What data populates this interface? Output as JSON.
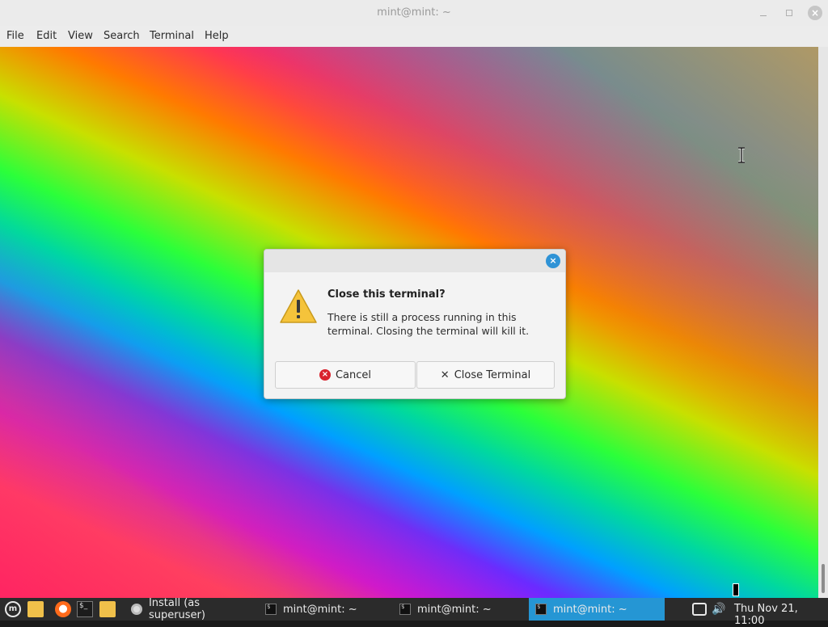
{
  "window": {
    "title": "mint@mint: ~",
    "controls": {
      "minimize": "minimize-icon",
      "maximize": "maximize-icon",
      "close": "close-icon"
    }
  },
  "menubar": {
    "items": [
      "File",
      "Edit",
      "View",
      "Search",
      "Terminal",
      "Help"
    ]
  },
  "dialog": {
    "heading": "Close this terminal?",
    "body": "There is still a process running in this terminal. Closing the terminal will kill it.",
    "cancel_label": "Cancel",
    "close_label": "Close Terminal",
    "icons": {
      "warning": "warning-icon",
      "cancel": "cancel-icon",
      "close": "x-icon"
    }
  },
  "taskbar": {
    "launchers": [
      "mint-menu-icon",
      "folder-icon",
      "firefox-icon",
      "terminal-icon",
      "files-icon"
    ],
    "tasks": [
      {
        "label": "Install (as superuser)",
        "icon": "cd-icon",
        "active": false
      },
      {
        "label": "mint@mint: ~",
        "icon": "terminal-icon",
        "active": false
      },
      {
        "label": "mint@mint: ~",
        "icon": "terminal-icon",
        "active": false
      },
      {
        "label": "mint@mint: ~",
        "icon": "terminal-icon",
        "active": true
      }
    ],
    "tray": [
      "network-icon",
      "volume-icon"
    ],
    "clock": "Thu Nov 21, 11:00"
  },
  "colors": {
    "taskbar_bg": "#2b2b2b",
    "active_task": "#2596d4",
    "dialog_close": "#2f93d6",
    "cancel_red": "#d9232d",
    "warning_yellow": "#f5c33b"
  }
}
